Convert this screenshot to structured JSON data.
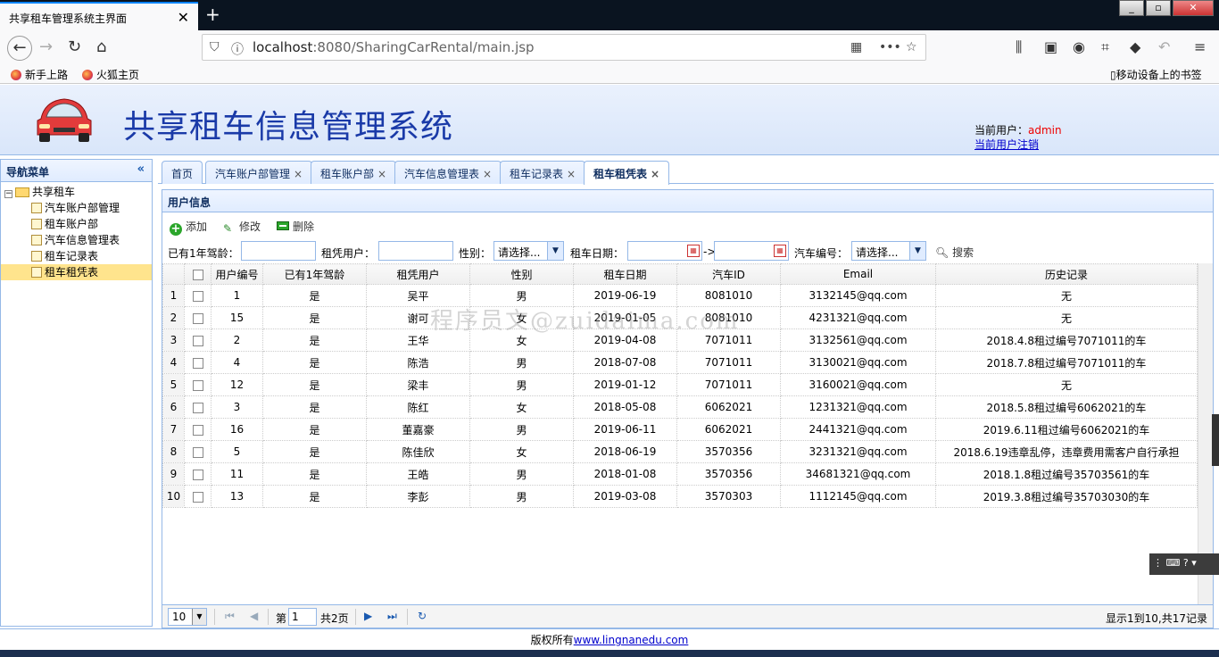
{
  "browser": {
    "tab_title": "共享租车管理系统主界面",
    "tab_close": "✕",
    "new_tab": "+",
    "url_host": "localhost",
    "url_path": ":8080/SharingCarRental/main.jsp",
    "bookmarks": [
      "新手上路",
      "火狐主页"
    ],
    "mobile_bookmarks": "移动设备上的书签"
  },
  "header": {
    "title": "共享租车信息管理系统",
    "current_user_label": "当前用户：",
    "current_user": "admin",
    "logout": "当前用户注销"
  },
  "sidebar": {
    "title": "导航菜单",
    "collapse": "«",
    "root": "共享租车",
    "items": [
      "汽车账户部管理",
      "租车账户部",
      "汽车信息管理表",
      "租车记录表",
      "租车租凭表"
    ],
    "selected": 4
  },
  "tabs": [
    {
      "label": "首页",
      "closable": false
    },
    {
      "label": "汽车账户部管理",
      "closable": true
    },
    {
      "label": "租车账户部",
      "closable": true
    },
    {
      "label": "汽车信息管理表",
      "closable": true
    },
    {
      "label": "租车记录表",
      "closable": true
    },
    {
      "label": "租车租凭表",
      "closable": true,
      "active": true
    }
  ],
  "panel": {
    "title": "用户信息"
  },
  "toolbar": {
    "add": "添加",
    "edit": "修改",
    "delete": "删除"
  },
  "filter": {
    "license_label": "已有1年驾龄：",
    "user_label": "租凭用户：",
    "gender_label": "性别：",
    "gender_value": "请选择...",
    "date_label": "租车日期：",
    "date_sep": "->",
    "car_label": "汽车编号：",
    "car_value": "请选择...",
    "search": "搜索"
  },
  "table": {
    "columns": [
      "用户编号",
      "已有1年驾龄",
      "租凭用户",
      "性别",
      "租车日期",
      "汽车ID",
      "Email",
      "历史记录"
    ],
    "rows": [
      [
        "1",
        "是",
        "吴平",
        "男",
        "2019-06-19",
        "8081010",
        "3132145@qq.com",
        "无"
      ],
      [
        "15",
        "是",
        "谢可",
        "女",
        "2019-01-05",
        "8081010",
        "4231321@qq.com",
        "无"
      ],
      [
        "2",
        "是",
        "王华",
        "女",
        "2019-04-08",
        "7071011",
        "3132561@qq.com",
        "2018.4.8租过编号7071011的车"
      ],
      [
        "4",
        "是",
        "陈浩",
        "男",
        "2018-07-08",
        "7071011",
        "3130021@qq.com",
        "2018.7.8租过编号7071011的车"
      ],
      [
        "12",
        "是",
        "梁丰",
        "男",
        "2019-01-12",
        "7071011",
        "3160021@qq.com",
        "无"
      ],
      [
        "3",
        "是",
        "陈红",
        "女",
        "2018-05-08",
        "6062021",
        "1231321@qq.com",
        "2018.5.8租过编号6062021的车"
      ],
      [
        "16",
        "是",
        "董嘉豪",
        "男",
        "2019-06-11",
        "6062021",
        "2441321@qq.com",
        "2019.6.11租过编号6062021的车"
      ],
      [
        "5",
        "是",
        "陈佳欣",
        "女",
        "2018-06-19",
        "3570356",
        "3231321@qq.com",
        "2018.6.19违章乱停，违章费用需客户自行承担"
      ],
      [
        "11",
        "是",
        "王皓",
        "男",
        "2018-01-08",
        "3570356",
        "34681321@qq.com",
        "2018.1.8租过编号35703561的车"
      ],
      [
        "13",
        "是",
        "李彭",
        "男",
        "2019-03-08",
        "3570303",
        "1112145@qq.com",
        "2019.3.8租过编号35703030的车"
      ]
    ]
  },
  "watermark": "程序员文@zuidaima.com",
  "pager": {
    "page_size": "10",
    "page_label": "第",
    "page": "1",
    "total_pages": "共2页",
    "summary": "显示1到10,共17记录"
  },
  "footer": {
    "copyright": "版权所有",
    "link": "www.lingnanedu.com"
  }
}
